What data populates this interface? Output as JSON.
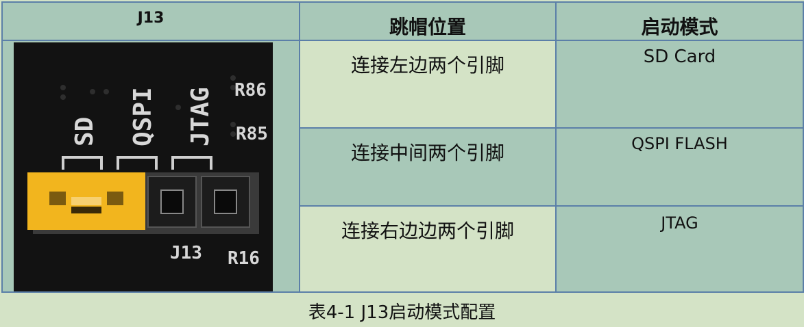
{
  "table": {
    "headers": [
      "J13",
      "跳帽位置",
      "启动模式"
    ],
    "rows": [
      {
        "position": "连接左边两个引脚",
        "mode": "SD Card"
      },
      {
        "position": "连接中间两个引脚",
        "mode": "QSPI FLASH"
      },
      {
        "position": "连接右边边两个引脚",
        "mode": "JTAG"
      }
    ]
  },
  "photo": {
    "labels": {
      "sd": "SD",
      "qspi": "QSPI",
      "jtag": "JTAG",
      "r86": "R86",
      "r85": "R85",
      "j13": "J13",
      "r16": "R16"
    }
  },
  "caption": "表4-1 J13启动模式配置",
  "colors": {
    "header_bg": "#a8c8b8",
    "light_bg": "#d4e3c6",
    "border": "#5b7fa8",
    "jumper": "#f2b51e"
  }
}
